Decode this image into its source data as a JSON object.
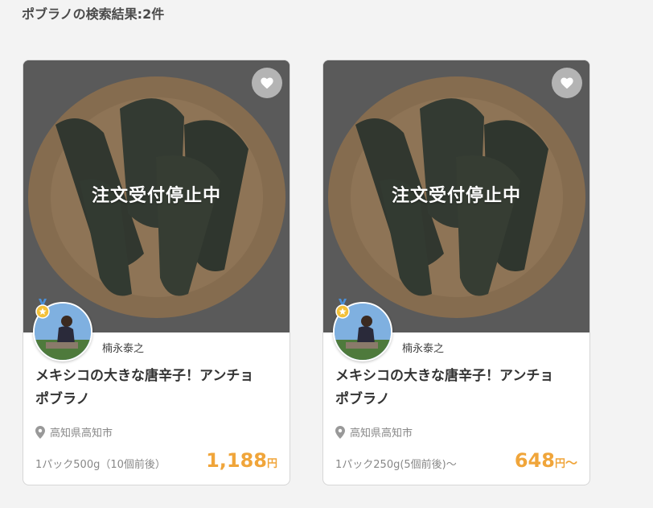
{
  "page": {
    "title": "ポブラノの検索結果:2件"
  },
  "cards": [
    {
      "status": "注文受付停止中",
      "producer": "楠永泰之",
      "name_line1": "メキシコの大きな唐辛子！アンチョ",
      "name_line2": "ポブラノ",
      "location": "高知県高知市",
      "unit": "1パック500g（10個前後）",
      "price": "1,188",
      "currency": "円",
      "suffix": ""
    },
    {
      "status": "注文受付停止中",
      "producer": "楠永泰之",
      "name_line1": "メキシコの大きな唐辛子！アンチョ",
      "name_line2": "ポブラノ",
      "location": "高知県高知市",
      "unit": "1パック250g(5個前後)〜",
      "price": "648",
      "currency": "円",
      "suffix": "〜"
    }
  ],
  "colors": {
    "accent_price": "#f0a53a",
    "background": "#f3f3f3"
  },
  "icons": {
    "favorite": "heart-icon",
    "location": "map-pin-icon",
    "badge": "medal-icon"
  }
}
